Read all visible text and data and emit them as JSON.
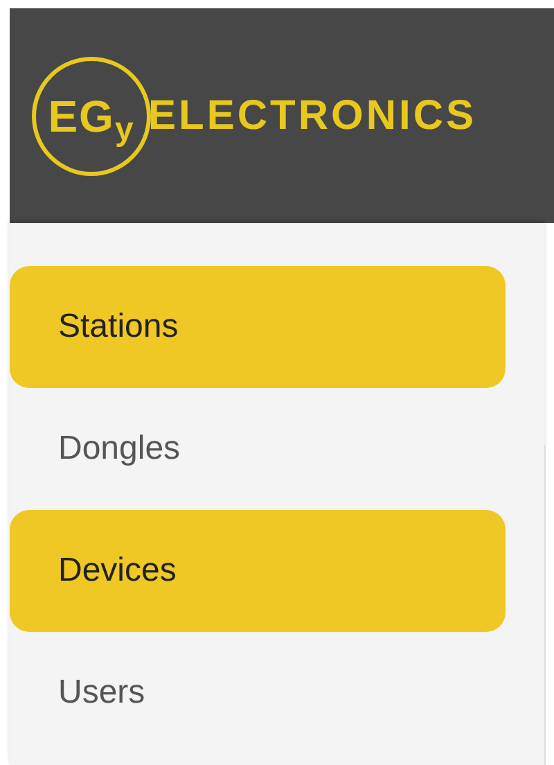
{
  "logo": {
    "badge": "EG$_{y}$",
    "name": "ELECTRONICS"
  },
  "sidebar": {
    "items": [
      {
        "label": "Stations",
        "selected": true
      },
      {
        "label": "Dongles",
        "selected": false
      },
      {
        "label": "Devices",
        "selected": true
      },
      {
        "label": "Users",
        "selected": false
      }
    ]
  }
}
